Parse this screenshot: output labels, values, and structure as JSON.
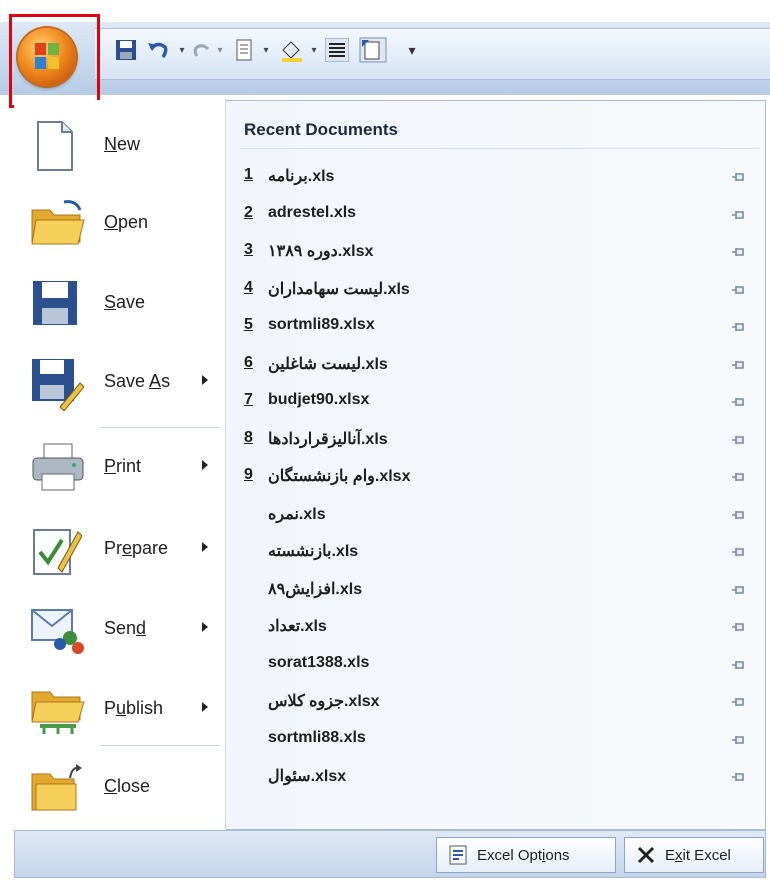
{
  "menu": {
    "items": [
      {
        "label_pre": "",
        "label_u": "N",
        "label_post": "ew",
        "arrow": false,
        "icon": "new-document-icon"
      },
      {
        "label_pre": "",
        "label_u": "O",
        "label_post": "pen",
        "arrow": false,
        "icon": "open-folder-icon"
      },
      {
        "label_pre": "",
        "label_u": "S",
        "label_post": "ave",
        "arrow": false,
        "icon": "save-disk-icon"
      },
      {
        "label_pre": "Save ",
        "label_u": "A",
        "label_post": "s",
        "arrow": true,
        "icon": "save-as-icon"
      },
      {
        "label_pre": "",
        "label_u": "P",
        "label_post": "rint",
        "arrow": true,
        "icon": "printer-icon"
      },
      {
        "label_pre": "Pr",
        "label_u": "e",
        "label_post": "pare",
        "arrow": true,
        "icon": "prepare-icon"
      },
      {
        "label_pre": "Sen",
        "label_u": "d",
        "label_post": "",
        "arrow": true,
        "icon": "send-icon"
      },
      {
        "label_pre": "P",
        "label_u": "u",
        "label_post": "blish",
        "arrow": true,
        "icon": "publish-icon"
      },
      {
        "label_pre": "",
        "label_u": "C",
        "label_post": "lose",
        "arrow": false,
        "icon": "close-folder-icon"
      }
    ]
  },
  "recent": {
    "title": "Recent Documents",
    "docs": [
      {
        "num": "1",
        "name": "برنامه.xls"
      },
      {
        "num": "2",
        "name": "adrestel.xls"
      },
      {
        "num": "3",
        "name": "دوره ۱۳۸۹.xlsx"
      },
      {
        "num": "4",
        "name": "لیست سهامداران.xls"
      },
      {
        "num": "5",
        "name": "sortmli89.xlsx"
      },
      {
        "num": "6",
        "name": "لیست شاغلین.xls"
      },
      {
        "num": "7",
        "name": "budjet90.xlsx"
      },
      {
        "num": "8",
        "name": "آنالیزقراردادها.xls"
      },
      {
        "num": "9",
        "name": "وام بازنشستگان.xlsx"
      },
      {
        "num": "",
        "name": "نمره.xls"
      },
      {
        "num": "",
        "name": "بازنشسته.xls"
      },
      {
        "num": "",
        "name": "افزایش۸۹.xls"
      },
      {
        "num": "",
        "name": "تعداد.xls"
      },
      {
        "num": "",
        "name": "sorat1388.xls"
      },
      {
        "num": "",
        "name": "جزوه کلاس.xlsx"
      },
      {
        "num": "",
        "name": "sortmli88.xls"
      },
      {
        "num": "",
        "name": "سئوال.xlsx"
      }
    ]
  },
  "footer": {
    "options_pre": "Excel Opt",
    "options_u": "i",
    "options_post": "ons",
    "exit_pre": "E",
    "exit_u": "x",
    "exit_post": "it Excel"
  },
  "colors": {
    "highlight_box": "#e00010",
    "office_orange": "#f08a1c",
    "frame_blue": "#a7bbd6"
  }
}
